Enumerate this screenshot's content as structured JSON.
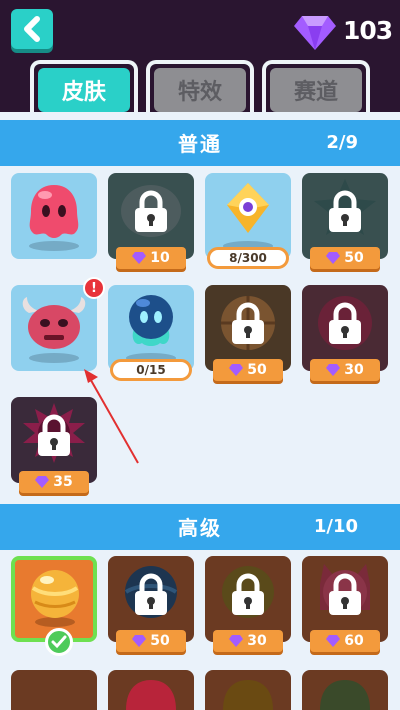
{
  "currency": {
    "gems": "103"
  },
  "tabs": [
    {
      "label": "皮肤",
      "active": true
    },
    {
      "label": "特效",
      "active": false
    },
    {
      "label": "赛道",
      "active": false
    }
  ],
  "sections": [
    {
      "title": "普通",
      "count": "2/9",
      "items": [
        {
          "state": "unlocked",
          "skin": "pink-jelly"
        },
        {
          "state": "locked",
          "price": "10"
        },
        {
          "state": "progress",
          "progress": "8/300"
        },
        {
          "state": "locked",
          "price": "50"
        },
        {
          "state": "unlocked",
          "skin": "red-horned",
          "alert": "!"
        },
        {
          "state": "progress",
          "skin": "teal-ghost",
          "progress": "0/15"
        },
        {
          "state": "locked",
          "price": "50"
        },
        {
          "state": "locked",
          "price": "30"
        },
        {
          "state": "locked",
          "price": "35"
        }
      ]
    },
    {
      "title": "高级",
      "count": "1/10",
      "items": [
        {
          "state": "selected",
          "skin": "gold-ball"
        },
        {
          "state": "locked",
          "price": "50"
        },
        {
          "state": "locked",
          "price": "30"
        },
        {
          "state": "locked",
          "price": "60"
        }
      ]
    }
  ],
  "colors": {
    "accent": "#2ad0c8",
    "header": "#35a7ec",
    "price": "#f39a3c",
    "gem": "#9b4dff"
  }
}
